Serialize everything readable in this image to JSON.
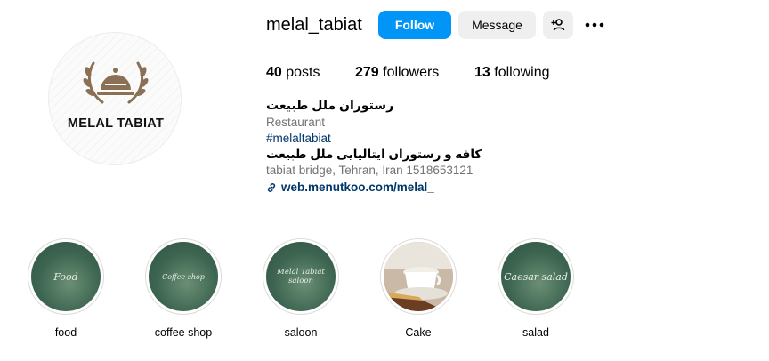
{
  "profile": {
    "username": "melal_tabiat",
    "avatar_text": "MELAL TABIAT",
    "avatar_icon": "cloche-laurel-emblem",
    "follow_label": "Follow",
    "message_label": "Message",
    "add_user_icon": "add-user-icon",
    "more_icon": "more-options-icon"
  },
  "stats": {
    "posts_count": "40",
    "posts_label": "posts",
    "followers_count": "279",
    "followers_label": "followers",
    "following_count": "13",
    "following_label": "following"
  },
  "bio": {
    "name": "رستوران ملل طبیعت",
    "category": "Restaurant",
    "hashtag": "#melaltabiat",
    "description": "کافه و رستوران ایتالیایی ملل طبیعت",
    "address": "tabiat bridge, Tehran, Iran 1518653121",
    "link": "web.menutkoo.com/melal_",
    "link_icon": "link-icon"
  },
  "highlights": [
    {
      "label": "food",
      "cover_text": "Food"
    },
    {
      "label": "coffee shop",
      "cover_text": "Coffee shop"
    },
    {
      "label": "saloon",
      "cover_text": "Melal Tabiat saloon"
    },
    {
      "label": "Cake",
      "cover_text": ""
    },
    {
      "label": "salad",
      "cover_text": "Caesar salad"
    }
  ],
  "colors": {
    "primary_button": "#0095f6",
    "secondary_button": "#efefef",
    "link": "#00376b",
    "muted_text": "#737373",
    "highlight_green": "#3c6450"
  }
}
